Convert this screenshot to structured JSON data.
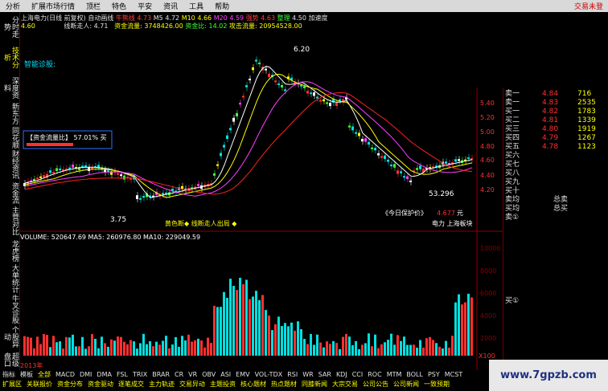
{
  "menubar": {
    "items": [
      "分析",
      "扩展市场行情",
      "顶栏",
      "特色",
      "平安",
      "资讯",
      "工具",
      "帮助"
    ],
    "warning": "交易未登"
  },
  "sidetabs": [
    "分时走势",
    "技术分析",
    "深度资料",
    "新东方",
    "同花顺",
    "财经资讯",
    "资金流",
    "主营对比",
    "龙虎榜",
    "大单统计",
    "牛叉诊股",
    "个股异动",
    "超级盘口",
    "Level-2"
  ],
  "info": {
    "title": "上海电力(日线 前复权) 自动画线",
    "niuxian_label": "牛熊线",
    "niuxian_val": "4.73",
    "m5_label": "M5",
    "m5_val": "4.72",
    "m10_label": "M10",
    "m10_val": "4.66",
    "m20_label": "M20",
    "m20_val": "4.59",
    "qiangshi_label": "强势",
    "qiangshi_val": "4.63",
    "zhengli_label": "整理",
    "zhengli_val": "4.50",
    "jiasu_label": "加速度",
    "row0_val": "4.60",
    "xianduan_label": "线断走人:",
    "xianduan_val": "4.71",
    "zjll_label": "资金流量:",
    "zjll_val": "3748426.00",
    "zjb_label": "资金比:",
    "zjb_val": "14.02",
    "gjll_label": "攻击流量:",
    "gjll_val": "20954528.00"
  },
  "chart_labels": {
    "zhineng": "智能诊股:",
    "high_price": "6.20",
    "low_price": "3.75",
    "low2_price": "53.296",
    "box_label": "【资金流量比】 57.01% 买",
    "huangse": "黄色断◆ 线断走人出局 ◆",
    "protect_label": "《今日保护价》",
    "protect_val": "4.677",
    "protect_unit": "元",
    "bankuai": "电力 上海板块",
    "vol_line": "VOLUME: 520647.69  MA5: 260976.80  MA10: 229049.59",
    "date_start": "2013年",
    "axis_x_end": "X100"
  },
  "right_axis": {
    "price_ticks": [
      "5.40",
      "5.20",
      "5.00",
      "4.80",
      "4.60",
      "4.40",
      "4.20"
    ],
    "vol_ticks": [
      "10000",
      "8000",
      "6000",
      "4000",
      "2000"
    ]
  },
  "orderbook": {
    "rows": [
      {
        "label": "卖一",
        "price": "4.84",
        "vol": "716"
      },
      {
        "label": "卖一",
        "price": "4.83",
        "vol": "2535"
      },
      {
        "label": "买一",
        "price": "4.82",
        "vol": "1783"
      },
      {
        "label": "买二",
        "price": "4.81",
        "vol": "1339"
      },
      {
        "label": "买三",
        "price": "4.80",
        "vol": "1919"
      },
      {
        "label": "买四",
        "price": "4.79",
        "vol": "1267"
      },
      {
        "label": "买五",
        "price": "4.78",
        "vol": "1123"
      },
      {
        "label": "买六",
        "price": "",
        "vol": ""
      },
      {
        "label": "买七",
        "price": "",
        "vol": ""
      },
      {
        "label": "买八",
        "price": "",
        "vol": ""
      },
      {
        "label": "买九",
        "price": "",
        "vol": ""
      },
      {
        "label": "买十",
        "price": "",
        "vol": ""
      }
    ],
    "junjia_sell_label": "卖均",
    "junjia_buy_label": "买均",
    "total_sell_label": "总卖",
    "total_buy_label": "总买",
    "sell_circle": "卖①",
    "buy_circle": "买①"
  },
  "bottomtabs": {
    "row1": [
      "指标",
      "模板",
      "全部",
      "MACD",
      "DMI",
      "DMA",
      "FSL",
      "TRIX",
      "BRAR",
      "CR",
      "VR",
      "OBV",
      "ASI",
      "EMV",
      "VOL-TDX",
      "RSI",
      "WR",
      "SAR",
      "KDJ",
      "CCI",
      "ROC",
      "MTM",
      "BOLL",
      "PSY",
      "MCST"
    ],
    "row2": [
      "扩展区",
      "关联报价",
      "资金分布",
      "资金驱动",
      "逐笔成交",
      "主力轨迹",
      "交易异动",
      "主题投资",
      "核心题材",
      "热点题材",
      "同膝新闻",
      "大宗交易",
      "公司公告",
      "公司新闻",
      "一致预期"
    ]
  },
  "watermark": "www.7gpzb.com",
  "colors": {
    "up": "#ff3030",
    "down": "#00e0e0",
    "ma5": "#ffffff",
    "ma10": "#ffff00",
    "ma20": "#ff40ff",
    "bg": "#000000",
    "grid": "#6b0000"
  }
}
